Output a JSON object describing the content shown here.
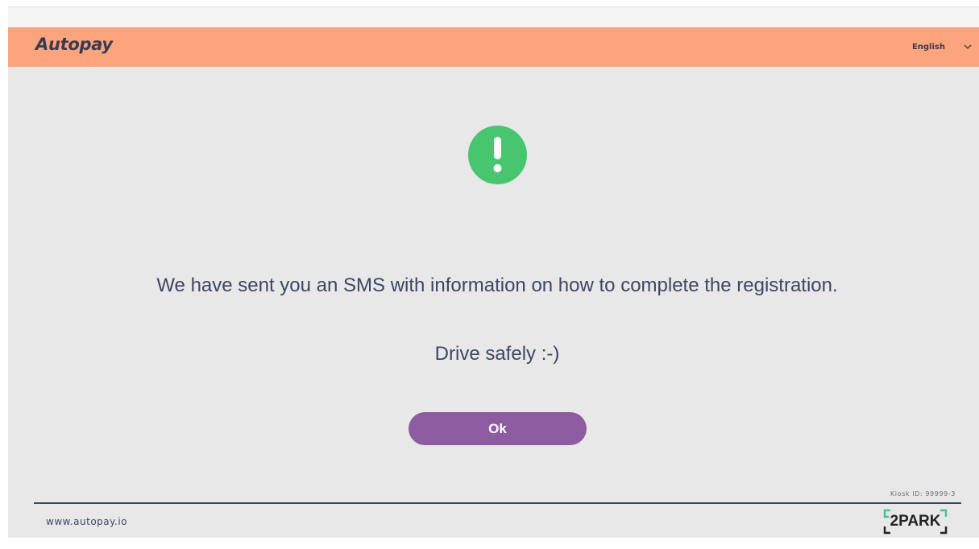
{
  "header": {
    "logo_text": "Autopay",
    "language": "English"
  },
  "main": {
    "icon": "exclamation-circle-icon",
    "message": "We have sent you an SMS with information on how to complete the registration.",
    "secondary_message": "Drive safely :-)",
    "ok_label": "Ok"
  },
  "footer": {
    "kiosk_id": "Kiosk ID: 99999-3",
    "website": "www.autopay.io",
    "partner_logo_text": "2PARK"
  },
  "colors": {
    "header_bg": "#fba47e",
    "kiosk_bg": "#e8e8e8",
    "accent_green": "#47c66f",
    "button_purple": "#8d5ba0",
    "text_dark": "#3d4664",
    "partner_bracket": "#45c490"
  }
}
